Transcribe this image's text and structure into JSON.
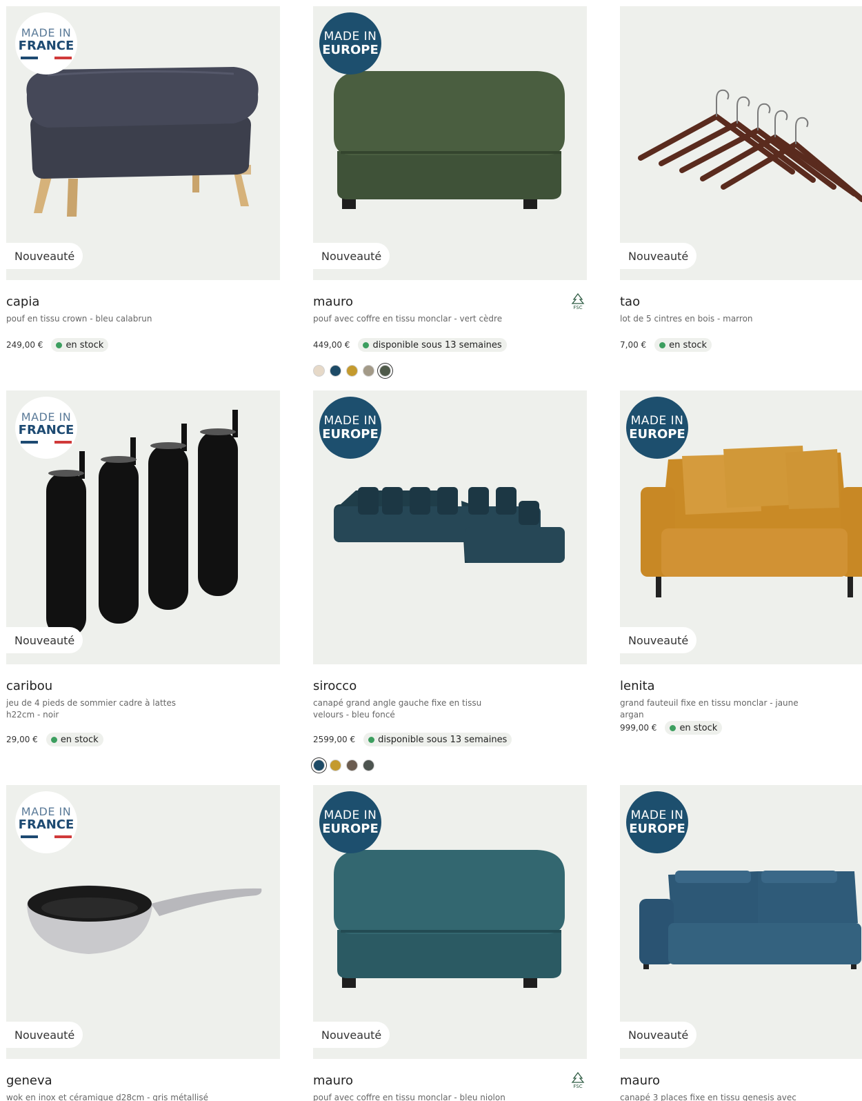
{
  "labels": {
    "nouveaute": "Nouveauté",
    "made_in": "MADE IN",
    "france": "FRANCE",
    "europe": "EUROPE",
    "fsc": "FSC"
  },
  "colors": {
    "image_bg": "#eef0ec",
    "badge_eu": "#1d4f6e",
    "stock_dot": "#3c9e5f",
    "flag_blue": "#1d4a72",
    "flag_red": "#d03a3a"
  },
  "products": [
    {
      "name": "capia",
      "desc": "pouf en tissu crown - bleu calabrun",
      "price": "249,00 €",
      "stock": "en stock",
      "badge": "made-in-france",
      "swatches": []
    },
    {
      "name": "mauro",
      "desc": "pouf avec coffre en tissu monclar - vert cèdre",
      "price": "449,00 €",
      "stock": "disponible sous 13 semaines",
      "badge": "made-in-europe",
      "fsc": true,
      "swatches": [
        "#e6d9c8",
        "#1d4a66",
        "#c49a2e",
        "#a39a88",
        "#4f5a4a"
      ],
      "selected_swatch": 4
    },
    {
      "name": "tao",
      "desc": "lot de 5 cintres en bois - marron",
      "price": "7,00 €",
      "stock": "en stock",
      "badge": "none",
      "swatches": []
    },
    {
      "name": "caribou",
      "desc": "jeu de 4 pieds de sommier cadre à lattes h22cm - noir",
      "price": "29,00 €",
      "stock": "en stock",
      "badge": "made-in-france",
      "swatches": []
    },
    {
      "name": "sirocco",
      "desc": "canapé grand angle gauche fixe en tissu velours - bleu foncé",
      "price": "2599,00 €",
      "stock": "disponible sous 13 semaines",
      "badge": "made-in-europe",
      "swatches": [
        "#1d4a66",
        "#c49a2e",
        "#6b5c50",
        "#4d5450"
      ],
      "selected_swatch": 0
    },
    {
      "name": "lenita",
      "desc": "grand fauteuil fixe en tissu monclar - jaune argan",
      "price": "999,00 €",
      "stock": "en stock",
      "badge": "made-in-europe",
      "swatches": []
    },
    {
      "name": "geneva",
      "desc": "wok en inox et céramique d28cm - gris métallisé",
      "badge": "made-in-france"
    },
    {
      "name": "mauro",
      "desc": "pouf avec coffre en tissu monclar - bleu niolon",
      "badge": "made-in-europe",
      "fsc": true
    },
    {
      "name": "mauro",
      "desc": "canapé 3 places fixe en tissu genesis avec",
      "badge": "made-in-europe"
    }
  ]
}
